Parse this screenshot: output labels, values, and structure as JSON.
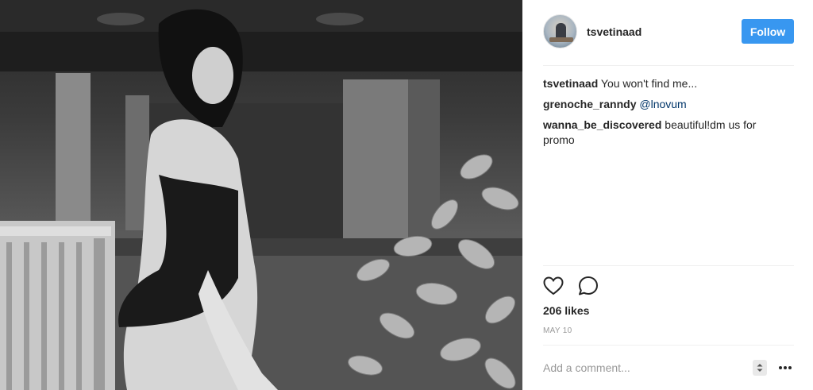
{
  "post": {
    "photo_alt_icon": "photo-image"
  },
  "header": {
    "username": "tsvetinaad",
    "follow_label": "Follow",
    "follow_color": "#3897f0"
  },
  "comments": [
    {
      "author": "tsvetinaad",
      "text": " You won't find me...",
      "mention": ""
    },
    {
      "author": "grenoche_ranndy",
      "text": " ",
      "mention": "@lnovum"
    },
    {
      "author": "wanna_be_discovered",
      "text": " beautiful!dm us for promo",
      "mention": ""
    }
  ],
  "actions": {
    "like_icon": "heart-icon",
    "comment_icon": "comment-bubble-icon"
  },
  "likes_text": "206 likes",
  "date_text": "MAY 10",
  "add_comment": {
    "placeholder": "Add a comment...",
    "more_icon": "ellipsis-icon"
  }
}
